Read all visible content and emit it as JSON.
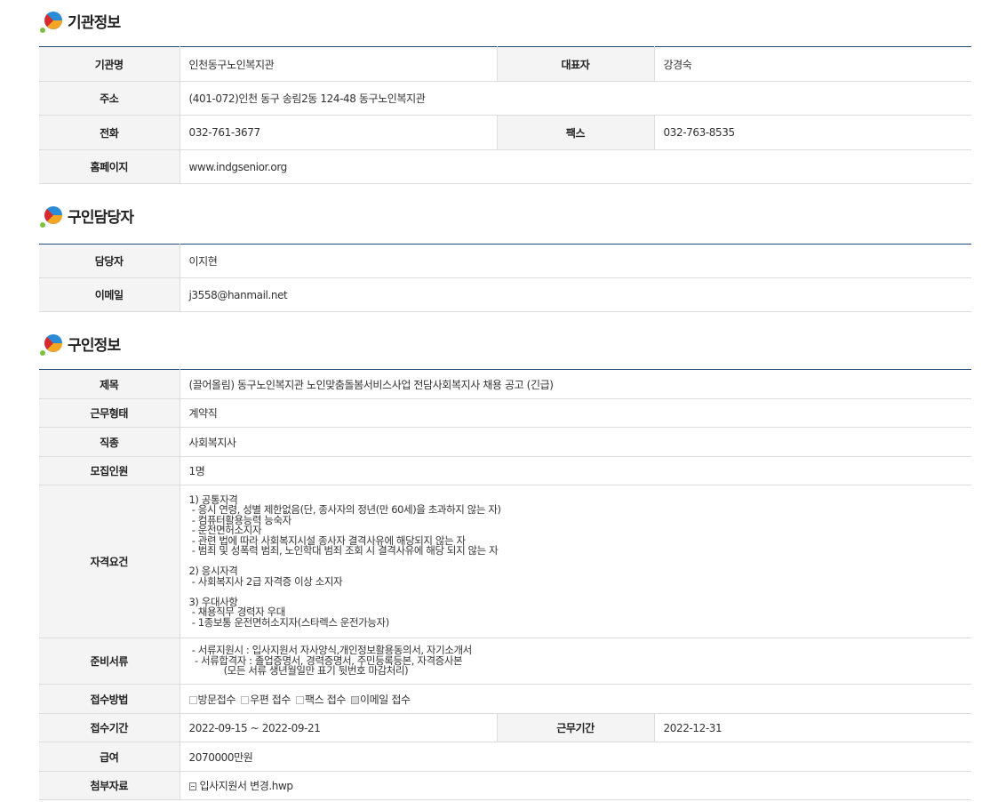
{
  "sections": {
    "org": {
      "title": "기관정보",
      "rows": {
        "name_label": "기관명",
        "name_value": "인천동구노인복지관",
        "rep_label": "대표자",
        "rep_value": "강경숙",
        "addr_label": "주소",
        "addr_value": "(401-072)인천 동구 송림2동 124-48 동구노인복지관",
        "tel_label": "전화",
        "tel_value": "032-761-3677",
        "fax_label": "팩스",
        "fax_value": "032-763-8535",
        "home_label": "홈페이지",
        "home_value": "www.indgsenior.org"
      }
    },
    "contact": {
      "title": "구인담당자",
      "rows": {
        "person_label": "담당자",
        "person_value": "이지현",
        "email_label": "이메일",
        "email_value": "j3558@hanmail.net"
      }
    },
    "job": {
      "title": "구인정보",
      "rows": {
        "subject_label": "제목",
        "subject_value": "(끌어올림) 동구노인복지관 노인맞춤돌봄서비스사업 전담사회복지사 채용 공고 (긴급)",
        "type_label": "근무형태",
        "type_value": "계약직",
        "kind_label": "직종",
        "kind_value": "사회복지사",
        "count_label": "모집인원",
        "count_value": "1명",
        "qual_label": "자격요건",
        "qual_value": "1) 공통자격\n - 응시 연령, 성별 제한없음(단, 종사자의 정년(만 60세)을 초과하지 않는 자)\n - 컴퓨터활용능력 능숙자\n - 운전면허소지자\n - 관련 법에 따라 사회복지시설 종사자 결격사유에 해당되지 않는 자\n - 범죄 및 성폭력 범죄, 노인학대 범죄 조회 시 결격사유에 해당 되지 않는 자\n\n2) 응시자격\n - 사회복지사 2급 자격증 이상 소지자\n\n3) 우대사항\n - 채용직무 경력자 우대\n - 1종보통 운전면허소지자(스타렉스 운전가능자)",
        "docs_label": "준비서류",
        "docs_value": " - 서류지원시 : 입사지원서 자사양식,개인정보활용동의서, 자기소개서\n  - 서류합격자 : 졸업증명서, 경력증명서, 주민등록등본, 자격증사본\n            (모든 서류 생년월일만 표기 뒷번호 마감처리)",
        "method_label": "접수방법",
        "method_options": [
          "방문접수",
          "우편 접수",
          "팩스 접수",
          "이메일 접수"
        ],
        "method_checked": [
          false,
          false,
          false,
          true
        ],
        "period_label": "접수기간",
        "period_value": "2022-09-15 ~ 2022-09-21",
        "workperiod_label": "근무기간",
        "workperiod_value": "2022-12-31",
        "salary_label": "급여",
        "salary_value": "2070000만원",
        "attach_label": "첨부자료",
        "attach_value": "입사지원서 변경.hwp"
      }
    }
  },
  "colors": {
    "table_top_border": "#1f4a7a",
    "header_bg": "#f4f4f4",
    "logo_blue": "#2a8bd6",
    "logo_orange": "#f6a623",
    "logo_red": "#d9292a",
    "logo_green": "#7cc242"
  }
}
